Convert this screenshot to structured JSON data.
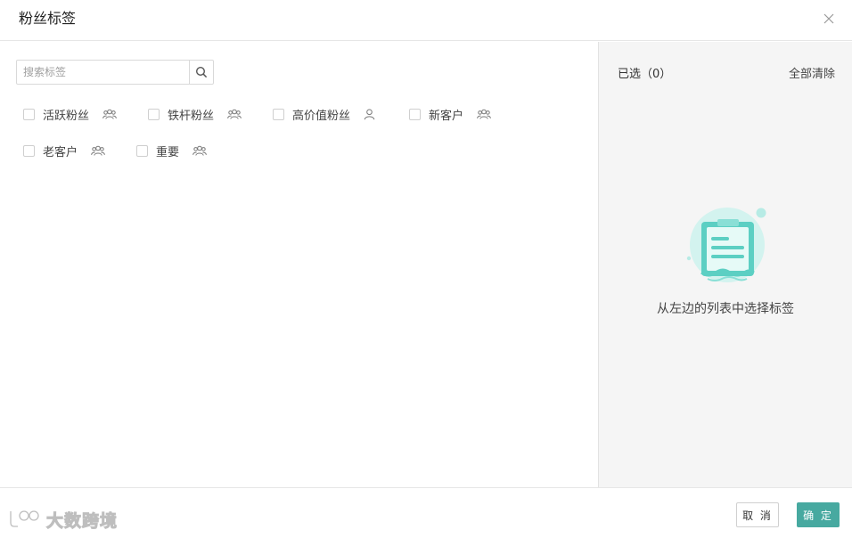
{
  "dialog": {
    "title": "粉丝标签",
    "close_icon": "close-icon"
  },
  "search": {
    "placeholder": "搜索标签",
    "value": "",
    "icon": "search-icon"
  },
  "tags": [
    {
      "label": "活跃粉丝",
      "icon": "group-icon",
      "checked": false
    },
    {
      "label": "铁杆粉丝",
      "icon": "group-icon",
      "checked": false
    },
    {
      "label": "高价值粉丝",
      "icon": "user-icon",
      "checked": false
    },
    {
      "label": "新客户",
      "icon": "group-icon",
      "checked": false
    },
    {
      "label": "老客户",
      "icon": "group-icon",
      "checked": false
    },
    {
      "label": "重要",
      "icon": "group-icon",
      "checked": false
    }
  ],
  "selected": {
    "title": "已选（0）",
    "clear_all": "全部清除",
    "empty_text": "从左边的列表中选择标签",
    "empty_icon": "clipboard-icon"
  },
  "footer": {
    "cancel_label": "取 消",
    "confirm_label": "确 定",
    "watermark_text": "大数跨境"
  },
  "colors": {
    "accent": "#47a9a0",
    "illustration_light": "#d3f3ef",
    "illustration_mid": "#5ccfc3",
    "panel_bg": "#f5f5f5"
  }
}
